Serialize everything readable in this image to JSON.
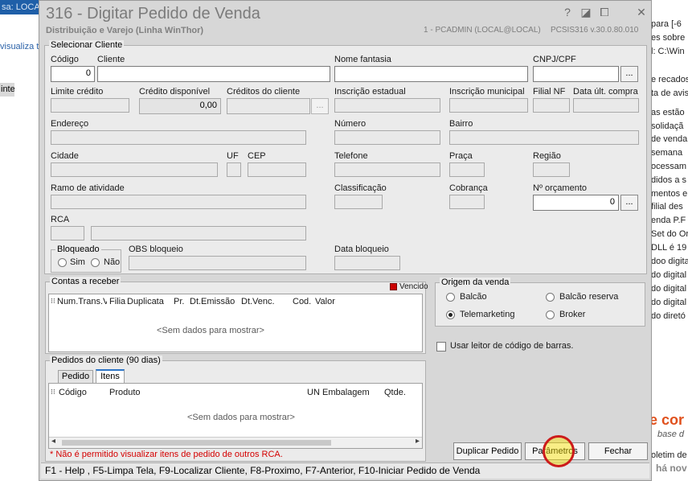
{
  "background": {
    "left_topbar": "sa: LOCA",
    "left_link": "visualiza t",
    "left_item": "inte",
    "right_lines": [
      "para [-6",
      "es sobre l",
      "l: C:\\Win",
      "e recados",
      "ta de avis",
      "as estão",
      "solidaçã",
      "de venda",
      "semana",
      "ocessam",
      "didos a s",
      "mentos en",
      "filial des",
      "enda P.F",
      "Set do Ora",
      "DLL é 19",
      "doo digital",
      "do digital",
      "do digital",
      "do digital",
      "do diretó"
    ],
    "right_big": "e cor",
    "right_base": "base d",
    "right_ha": "há nov",
    "right_oletim": "oletim de h"
  },
  "window": {
    "title": "316 - Digitar Pedido de Venda",
    "subtitle": "Distribuição e Varejo (Linha WinThor)",
    "user": "1 - PCADMIN (LOCAL@LOCAL)",
    "version": "PCSIS316  v.30.0.80.010",
    "help_glyph": "?",
    "restore_glyph": "◪",
    "min_glyph": "⧠",
    "close_glyph": "✕"
  },
  "cliente": {
    "group_title": "Selecionar Cliente",
    "codigo_label": "Código",
    "codigo_value": "0",
    "cliente_label": "Cliente",
    "nome_fantasia_label": "Nome fantasia",
    "cnpj_label": "CNPJ/CPF",
    "limite_label": "Limite crédito",
    "credito_disp_label": "Crédito disponível",
    "credito_disp_value": "0,00",
    "creditos_cliente_label": "Créditos do cliente",
    "insc_estadual_label": "Inscrição estadual",
    "insc_municipal_label": "Inscrição municipal",
    "filial_nf_label": "Filial NF",
    "data_ult_compra_label": "Data últ. compra",
    "endereco_label": "Endereço",
    "numero_label": "Número",
    "bairro_label": "Bairro",
    "cidade_label": "Cidade",
    "uf_label": "UF",
    "cep_label": "CEP",
    "telefone_label": "Telefone",
    "praca_label": "Praça",
    "regiao_label": "Região",
    "ramo_label": "Ramo de atividade",
    "classificacao_label": "Classificação",
    "cobranca_label": "Cobrança",
    "orcamento_label": "Nº orçamento",
    "orcamento_value": "0",
    "rca_label": "RCA",
    "bloqueado_title": "Bloqueado",
    "sim_label": "Sim",
    "nao_label": "Não",
    "obs_bloqueio_label": "OBS bloqueio",
    "data_bloqueio_label": "Data bloqueio",
    "dots": "..."
  },
  "contas": {
    "title": "Contas a receber",
    "vencido_label": "Vencido",
    "vencido_color": "#cc0000",
    "columns": [
      "Num.Trans.V",
      "Filia",
      "Duplicata",
      "Pr.",
      "Dt.Emissão",
      "Dt.Venc.",
      "Cod.",
      "Valor"
    ],
    "empty": "<Sem dados para mostrar>"
  },
  "origem": {
    "title": "Origem da venda",
    "balcao": "Balcão",
    "balcao_reserva": "Balcão reserva",
    "telemarketing": "Telemarketing",
    "broker": "Broker",
    "selected": "Telemarketing"
  },
  "leitor_label": "Usar leitor de código de barras.",
  "pedidos": {
    "title": "Pedidos do cliente (90 dias)",
    "tabs": [
      "Pedido",
      "Itens"
    ],
    "active_tab": "Itens",
    "columns": [
      "Código",
      "Produto",
      "UN",
      "Embalagem",
      "Qtde."
    ],
    "empty": "<Sem dados para mostrar>",
    "warning": "* Não é permitido visualizar itens de pedido de outros RCA."
  },
  "buttons": {
    "duplicar": "Duplicar Pedido",
    "parametros": "Parâmetros",
    "fechar": "Fechar"
  },
  "statusbar": "F1 - Help , F5-Limpa Tela, F9-Localizar Cliente, F8-Proximo, F7-Anterior, F10-Iniciar Pedido de Venda"
}
